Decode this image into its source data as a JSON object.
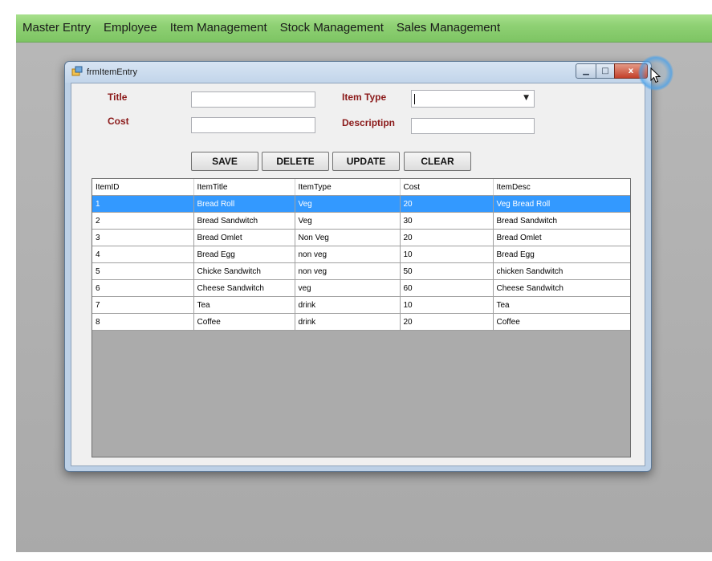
{
  "menu": [
    "Master Entry",
    "Employee",
    "Item Management",
    "Stock Management",
    "Sales Management"
  ],
  "window": {
    "title": "frmItemEntry",
    "min_glyph": "▁",
    "max_glyph": "□",
    "close_glyph": "x"
  },
  "form": {
    "title_label": "Title",
    "cost_label": "Cost",
    "item_type_label": "Item Type",
    "description_label": "Descriptipn",
    "title_value": "",
    "cost_value": "",
    "item_type_value": "",
    "description_value": "",
    "combo_arrow": "▼"
  },
  "buttons": {
    "save": "SAVE",
    "delete": "DELETE",
    "update": "UPDATE",
    "clear": "CLEAR"
  },
  "grid": {
    "columns": [
      "ItemID",
      "ItemTitle",
      "ItemType",
      "Cost",
      "ItemDesc"
    ],
    "rows": [
      [
        "1",
        "Bread Roll",
        "Veg",
        "20",
        "Veg Bread Roll"
      ],
      [
        "2",
        "Bread Sandwitch",
        "Veg",
        "30",
        "Bread Sandwitch"
      ],
      [
        "3",
        "Bread Omlet",
        "Non Veg",
        "20",
        "Bread Omlet"
      ],
      [
        "4",
        "Bread  Egg",
        "non veg",
        "10",
        "Bread Egg"
      ],
      [
        "5",
        "Chicke Sandwitch",
        "non veg",
        "50",
        "chicken Sandwitch"
      ],
      [
        "6",
        "Cheese Sandwitch",
        "veg",
        "60",
        "Cheese Sandwitch"
      ],
      [
        "7",
        "Tea",
        "drink",
        "10",
        "Tea"
      ],
      [
        "8",
        "Coffee",
        "drink",
        "20",
        "Coffee"
      ]
    ],
    "selected_row": 0
  },
  "colors": {
    "menubar": "#8fd174",
    "label_text": "#8b1a1a",
    "selection": "#3399ff",
    "close_button": "#c4402a"
  }
}
